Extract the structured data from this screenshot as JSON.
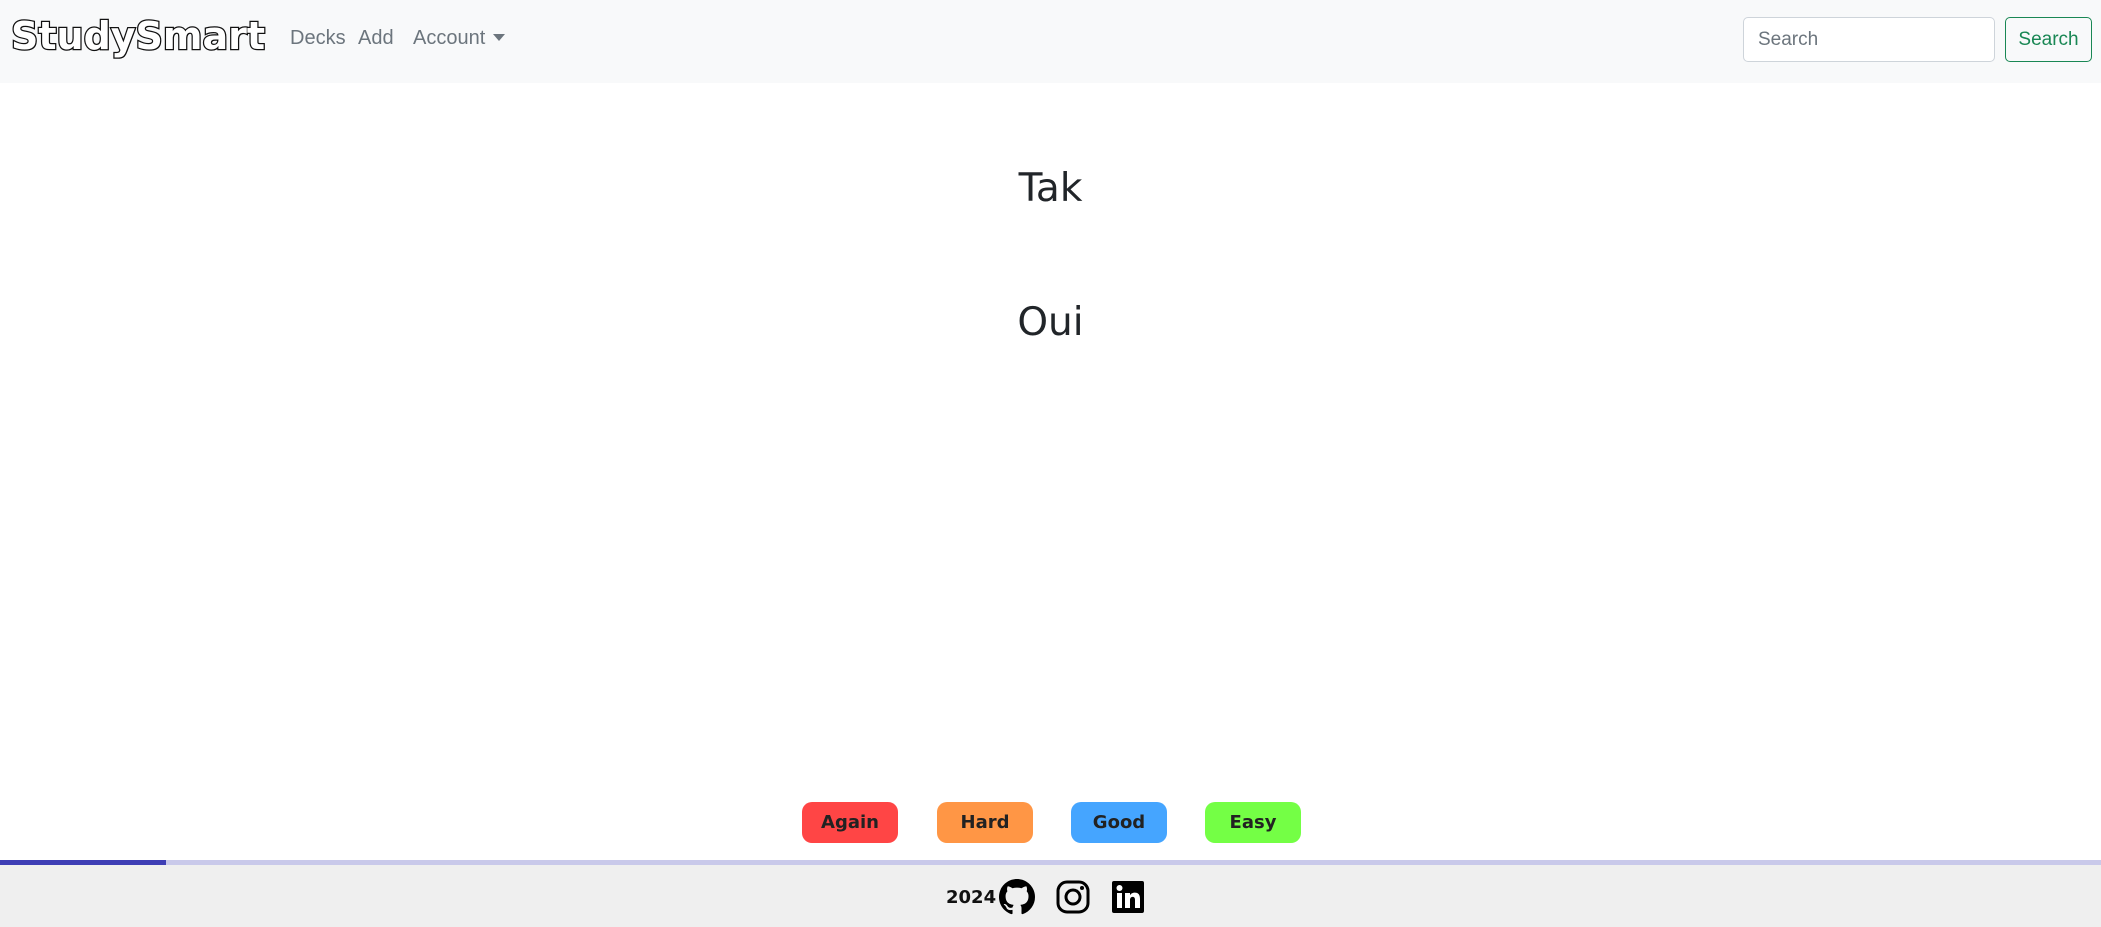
{
  "navbar": {
    "brand": "StudySmart",
    "links": {
      "decks": "Decks",
      "add": "Add",
      "account": "Account"
    },
    "search": {
      "placeholder": "Search",
      "value": "",
      "button_label": "Search"
    }
  },
  "card": {
    "front": "Tak",
    "back": "Oui"
  },
  "answer_buttons": [
    {
      "label": "Again",
      "color": "#ff4545"
    },
    {
      "label": "Hard",
      "color": "#ff9645"
    },
    {
      "label": "Good",
      "color": "#45a5ff"
    },
    {
      "label": "Easy",
      "color": "#74ff45"
    }
  ],
  "progress": {
    "fraction": 0.079,
    "track_color": "#c9c9ea",
    "fill_color": "#3e3eb5"
  },
  "footer": {
    "year": "2024",
    "icons": [
      "github-icon",
      "instagram-icon",
      "linkedin-icon"
    ]
  }
}
